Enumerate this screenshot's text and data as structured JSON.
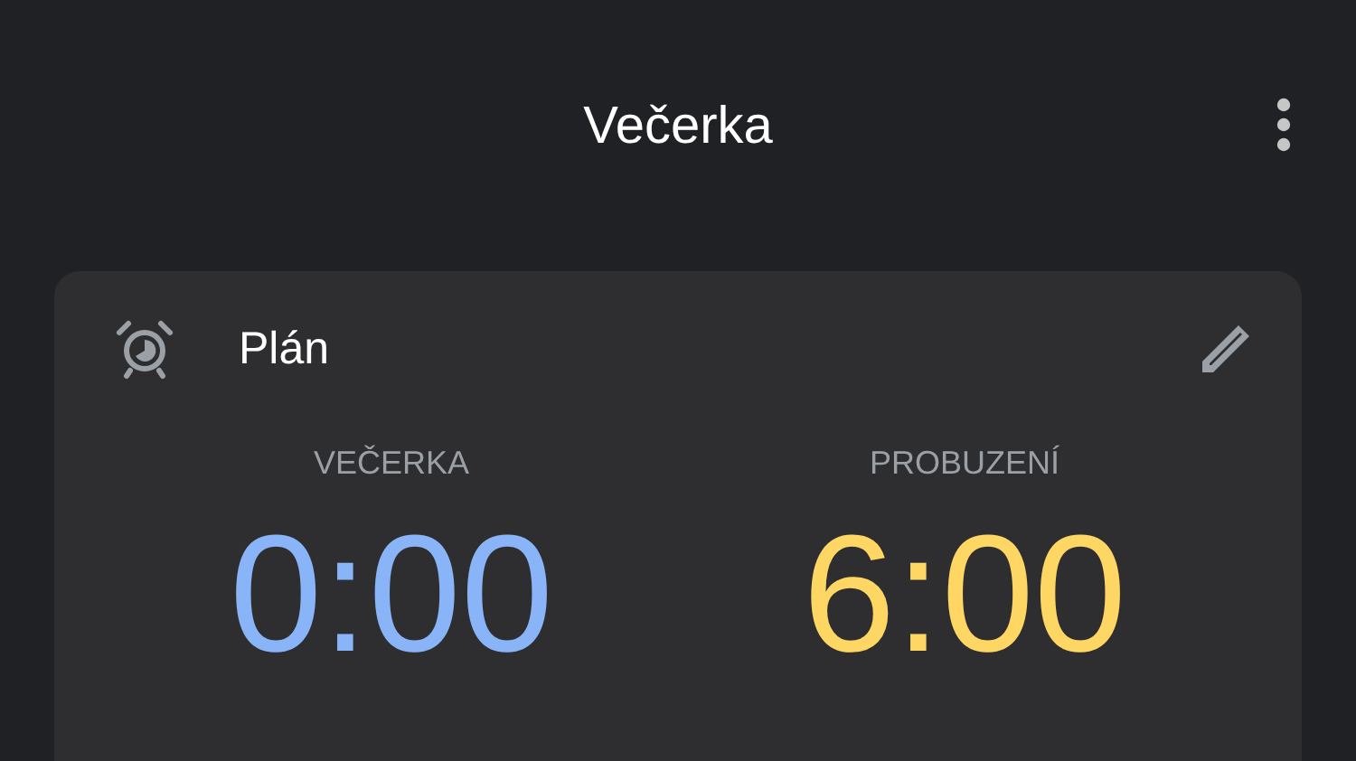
{
  "app_bar": {
    "title": "Večerka"
  },
  "card": {
    "title": "Plán",
    "times": [
      {
        "label": "VEČERKA",
        "value": "0:00",
        "color": "#8ab4f8"
      },
      {
        "label": "PROBUZENÍ",
        "value": "6:00",
        "color": "#fdd663"
      }
    ]
  }
}
